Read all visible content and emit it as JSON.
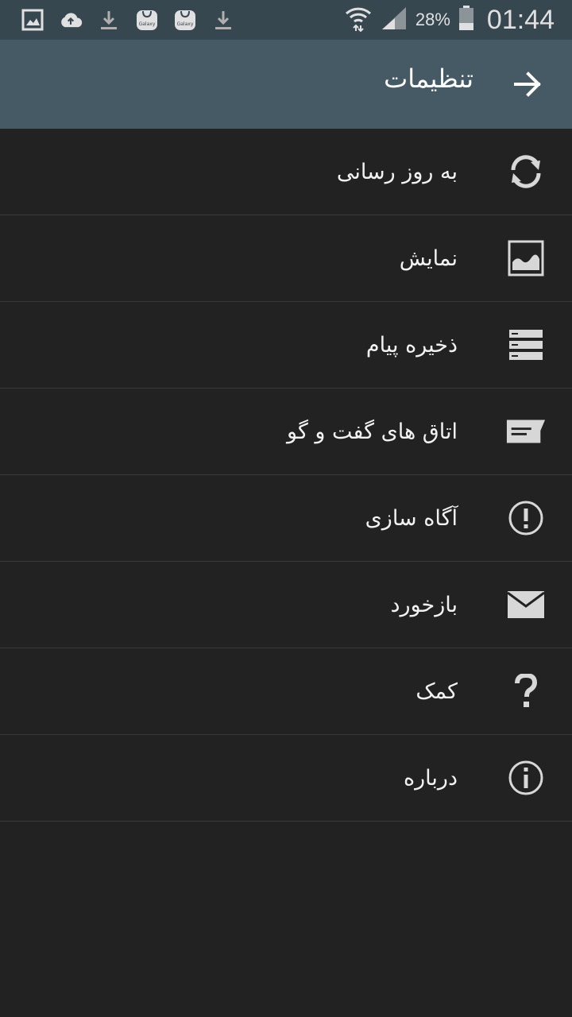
{
  "status_bar": {
    "battery_percent": "28%",
    "time": "01:44",
    "icons": [
      "gallery-icon",
      "cloud-upload-icon",
      "download-icon",
      "galaxy-store-icon",
      "galaxy-store-icon",
      "download-icon",
      "wifi-icon",
      "signal-icon",
      "battery-icon"
    ],
    "galaxy_label": "Galaxy"
  },
  "app_bar": {
    "title": "تنظیمات",
    "back_icon": "arrow-right-icon"
  },
  "menu": {
    "items": [
      {
        "label": "به روز رسانی",
        "icon": "refresh-icon"
      },
      {
        "label": "نمایش",
        "icon": "image-icon"
      },
      {
        "label": "ذخیره پیام",
        "icon": "storage-icon"
      },
      {
        "label": "اتاق های گفت و گو",
        "icon": "chat-room-icon"
      },
      {
        "label": "آگاه سازی",
        "icon": "alert-icon"
      },
      {
        "label": "بازخورد",
        "icon": "mail-icon"
      },
      {
        "label": "کمک",
        "icon": "help-icon"
      },
      {
        "label": "درباره",
        "icon": "info-icon"
      }
    ]
  },
  "colors": {
    "status_bar": "#37474f",
    "app_bar": "#455a64",
    "background": "#222222",
    "divider": "#3a3a3a",
    "icon": "#d7d7d7"
  }
}
